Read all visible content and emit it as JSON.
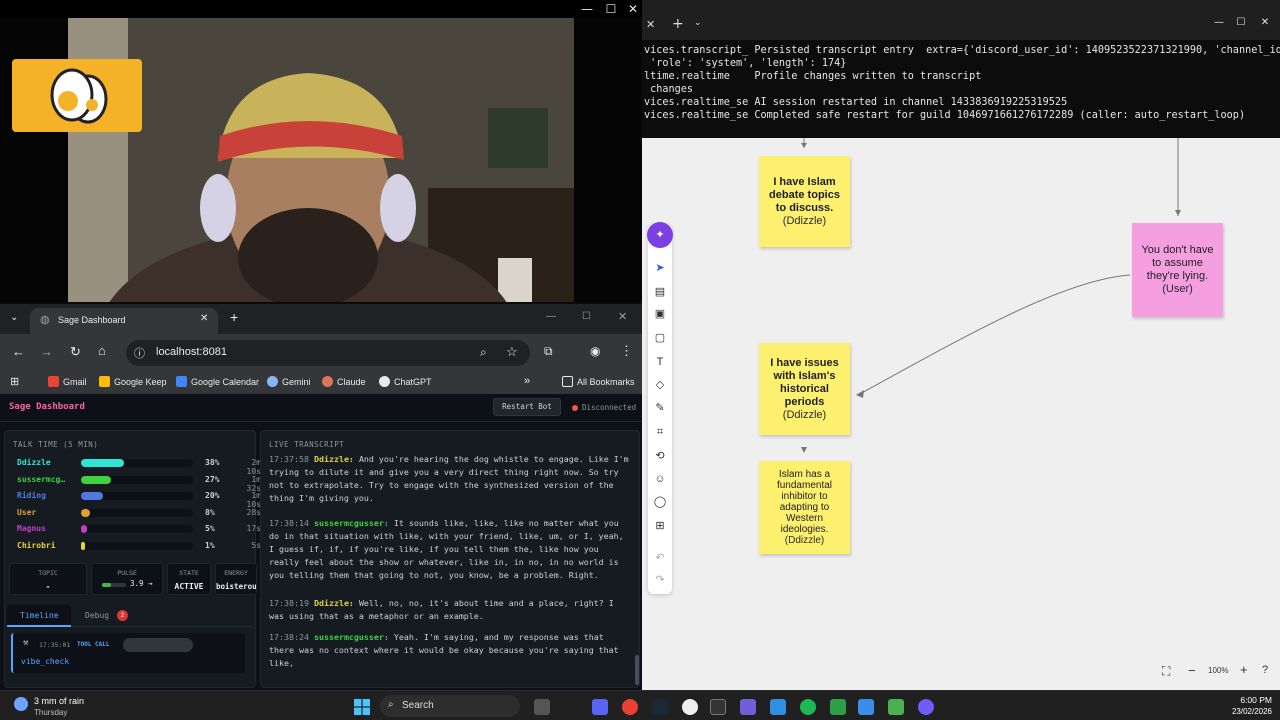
{
  "cam_window": {
    "min": "—",
    "max": "☐",
    "close": "✕"
  },
  "terminal": {
    "lines": [
      "vices.transcript_ Persisted transcript entry  extra={'discord_user_id': 1409523522371321990, 'channel_id",
      " 'role': 'system', 'length': 174}",
      "ltime.realtime    Profile changes written to transcript",
      " changes",
      "vices.realtime_se AI session restarted in channel 1433836919225319525",
      "vices.realtime_se Completed safe restart for guild 1046971661276172289 (caller: auto_restart_loop)"
    ]
  },
  "canvas": {
    "notes": [
      {
        "text": "I have Islam debate topics to discuss.",
        "author": "(Ddizzle)"
      },
      {
        "text": "You don't have to assume they're lying.",
        "author": "(User)"
      },
      {
        "text": "I have issues with Islam's historical periods",
        "author": "(Ddizzle)"
      },
      {
        "text": "Islam has a fundamental inhibitor to adapting to Western ideologies.",
        "author": "(Ddizzle)"
      }
    ],
    "zoom": "100%",
    "colors": {
      "yellow": "#fdf06f",
      "pink": "#f59ee0"
    }
  },
  "browser": {
    "tab_title": "Sage Dashboard",
    "url": "localhost:8081",
    "bookmarks": [
      {
        "label": "Gmail",
        "color": "#ea4335"
      },
      {
        "label": "Google Keep",
        "color": "#fbbc04"
      },
      {
        "label": "Google Calendar",
        "color": "#4285f4"
      },
      {
        "label": "Gemini",
        "color": "#8ab4f8"
      },
      {
        "label": "Claude",
        "color": "#d97757"
      },
      {
        "label": "ChatGPT",
        "color": "#e8eaed"
      }
    ],
    "all_bookmarks": "All Bookmarks"
  },
  "dashboard": {
    "title": "Sage Dashboard",
    "restart_label": "Restart Bot",
    "status": "Disconnected",
    "talk_time_title": "TALK TIME",
    "talk_time_window": "(5 MIN)",
    "speakers": [
      {
        "name": "Ddizzle",
        "pct": "38%",
        "time": "2m 10s",
        "share": 0.38,
        "color": "#2ee6d6"
      },
      {
        "name": "sussermcg…",
        "pct": "27%",
        "time": "1m 32s",
        "share": 0.27,
        "color": "#3fd13f"
      },
      {
        "name": "Riding",
        "pct": "20%",
        "time": "1m 10s",
        "share": 0.2,
        "color": "#4f7be0"
      },
      {
        "name": "User",
        "pct": "8%",
        "time": "28s",
        "share": 0.08,
        "color": "#e0a030"
      },
      {
        "name": "Magnus",
        "pct": "5%",
        "time": "17s",
        "share": 0.05,
        "color": "#c040c0"
      },
      {
        "name": "Chirobri",
        "pct": "1%",
        "time": "5s",
        "share": 0.01,
        "color": "#e6d23a"
      }
    ],
    "stats": {
      "topic_label": "TOPIC",
      "topic": "-",
      "pulse_label": "PULSE",
      "pulse": "3.9 →",
      "pulse_level": 0.39,
      "state_label": "STATE",
      "state": "ACTIVE",
      "energy_label": "ENERGY",
      "energy": "boisterous"
    },
    "tabs": {
      "timeline": "Timeline",
      "debug": "Debug",
      "debug_count": "2"
    },
    "timeline_entry": {
      "time": "17:35:01",
      "kind": "TOOL CALL",
      "name": "vibe_check"
    },
    "transcript_title": "LIVE TRANSCRIPT",
    "transcript": [
      {
        "ts": "17:37:58",
        "speaker": "Ddizzle:",
        "color": "#e6d23a",
        "text": "And you're hearing the dog whistle to engage. Like I'm trying to dilute it and give you a very direct thing right now. So try not to extrapolate. Try to engage with the synthesized version of the thing I'm giving you."
      },
      {
        "ts": "17:38:14",
        "speaker": "sussermcgusser:",
        "color": "#3fd13f",
        "text": "It sounds like, like, like no matter what you do in that situation with like, with your friend, like, um, or I, yeah, I guess if, if, if you're like, if you tell them the, like how you really feel about the show or whatever, like in, in no, in no world is you telling them that going to not, you know, be a problem. Right."
      },
      {
        "ts": "17:38:19",
        "speaker": "Ddizzle:",
        "color": "#e6d23a",
        "text": "Well, no, no, it's about time and a place, right? I was using that as a metaphor or an example."
      },
      {
        "ts": "17:38:24",
        "speaker": "sussermcgusser:",
        "color": "#3fd13f",
        "text": "Yeah. I'm saying, and my response was that there was no context where it would be okay because you're saying that like,"
      }
    ]
  },
  "taskbar": {
    "weather": "3 mm of rain",
    "day": "Thursday",
    "search": "Search",
    "time": "6:00 PM",
    "date": "23/02/2026"
  }
}
